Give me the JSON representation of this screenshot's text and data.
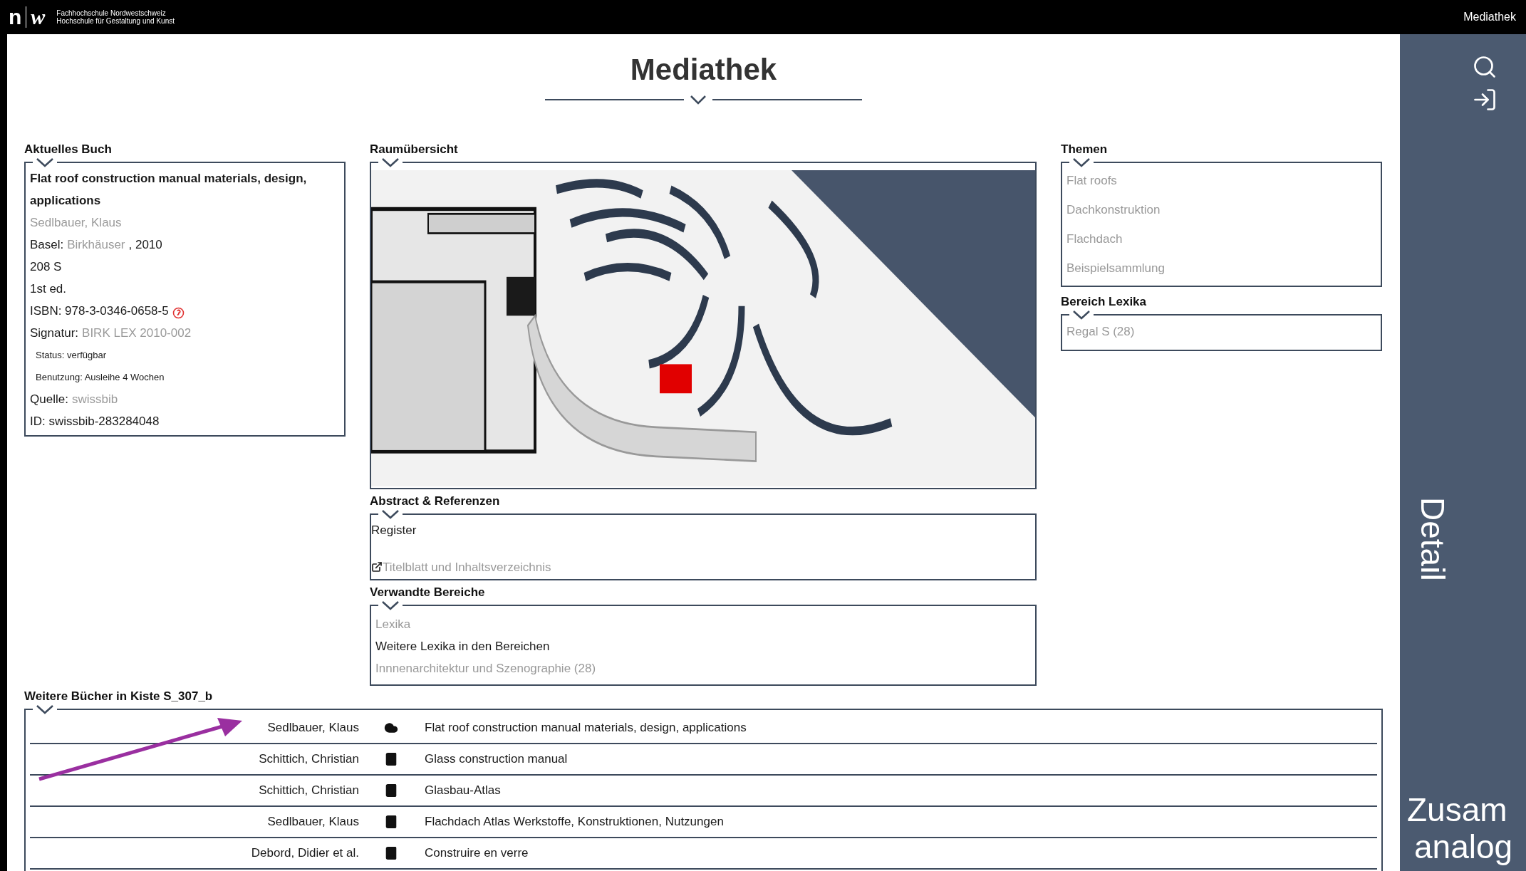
{
  "header": {
    "logo_letters": [
      "n",
      "w"
    ],
    "org_lines": [
      "Fachhochschule Nordwestschweiz",
      "Hochschule für Gestaltung und Kunst"
    ],
    "nav_title": "Mediathek"
  },
  "page_title": "Mediathek",
  "current_book": {
    "heading": "Aktuelles Buch",
    "title": "Flat roof construction manual materials, design, applications",
    "lines": [
      {
        "kind": "normal",
        "parts": [
          {
            "kind": "link",
            "text": "Sedlbauer, Klaus"
          }
        ]
      },
      {
        "kind": "normal",
        "parts": [
          {
            "kind": "plain",
            "text": "Basel:"
          },
          {
            "kind": "link",
            "text": "Birkhäuser"
          },
          {
            "kind": "plain",
            "text": ", 2010"
          }
        ]
      },
      {
        "kind": "normal",
        "parts": [
          {
            "kind": "plain",
            "text": "208 S"
          }
        ]
      },
      {
        "kind": "normal",
        "parts": [
          {
            "kind": "plain",
            "text": "1st ed."
          }
        ]
      },
      {
        "kind": "normal",
        "badge": true,
        "parts": [
          {
            "kind": "plain",
            "text": "ISBN: 978-3-0346-0658-5"
          }
        ]
      },
      {
        "kind": "normal",
        "parts": [
          {
            "kind": "plain",
            "text": "Signatur:"
          },
          {
            "kind": "link",
            "text": "BIRK LEX 2010-002"
          }
        ]
      },
      {
        "kind": "small",
        "parts": [
          {
            "kind": "plain",
            "text": "Status: verfügbar"
          }
        ]
      },
      {
        "kind": "small",
        "parts": [
          {
            "kind": "plain",
            "text": "Benutzung: Ausleihe 4 Wochen"
          }
        ]
      },
      {
        "kind": "normal",
        "parts": [
          {
            "kind": "plain",
            "text": "Quelle:"
          },
          {
            "kind": "link",
            "text": "swissbib"
          }
        ]
      },
      {
        "kind": "normal",
        "parts": [
          {
            "kind": "plain",
            "text": "ID: swissbib-283284048"
          }
        ]
      }
    ]
  },
  "room": {
    "heading": "Raumübersicht"
  },
  "abstract": {
    "heading": "Abstract & Referenzen",
    "text": "Register",
    "link": "Titelblatt und Inhaltsverzeichnis"
  },
  "related": {
    "heading": "Verwandte Bereiche",
    "items": [
      {
        "kind": "link",
        "text": "Lexika"
      },
      {
        "kind": "plain",
        "text": "Weitere Lexika in den Bereichen"
      },
      {
        "kind": "link",
        "text": "Innnenarchitektur und Szenographie (28)"
      }
    ]
  },
  "topics": {
    "heading": "Themen",
    "items": [
      "Flat roofs",
      "Dachkonstruktion",
      "Flachdach",
      "Beispielsammlung"
    ]
  },
  "lexika": {
    "heading": "Bereich Lexika",
    "items": [
      "Regal S (28)"
    ]
  },
  "more_books": {
    "heading": "Weitere Bücher in Kiste S_307_b",
    "rows": [
      {
        "author": "Sedlbauer, Klaus",
        "kind": "online",
        "title": "Flat roof construction manual materials, design, applications"
      },
      {
        "author": "Schittich, Christian",
        "kind": "book",
        "title": "Glass construction manual"
      },
      {
        "author": "Schittich, Christian",
        "kind": "book",
        "title": "Glasbau-Atlas"
      },
      {
        "author": "Sedlbauer, Klaus",
        "kind": "book",
        "title": "Flachdach Atlas Werkstoffe, Konstruktionen, Nutzungen"
      },
      {
        "author": "Debord, Didier et al.",
        "kind": "book",
        "title": "Construire en verre"
      }
    ]
  },
  "sidebar": {
    "tab_label": "Detail",
    "next_lines": [
      "Zusam",
      "analog"
    ]
  }
}
